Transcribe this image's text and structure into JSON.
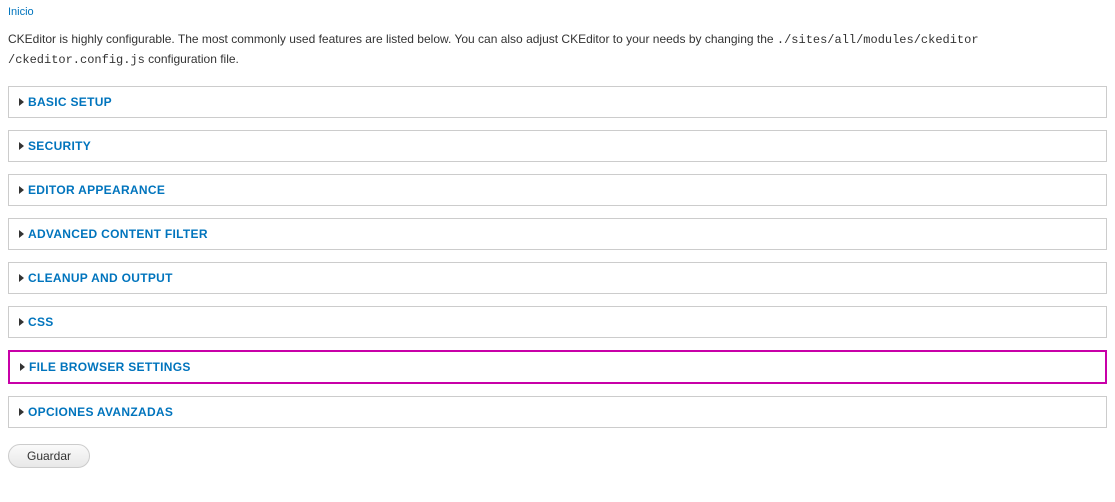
{
  "breadcrumb": {
    "home": "Inicio"
  },
  "description": {
    "text_before": "CKEditor is highly configurable. The most commonly used features are listed below. You can also adjust CKEditor to your needs by changing the ",
    "code1": "./sites/all/modules/ckeditor",
    "code2": "/ckeditor.config.js",
    "text_after": " configuration file."
  },
  "fieldsets": [
    {
      "label": "BASIC SETUP"
    },
    {
      "label": "SECURITY"
    },
    {
      "label": "EDITOR APPEARANCE"
    },
    {
      "label": "ADVANCED CONTENT FILTER"
    },
    {
      "label": "CLEANUP AND OUTPUT"
    },
    {
      "label": "CSS"
    },
    {
      "label": "FILE BROWSER SETTINGS"
    },
    {
      "label": "OPCIONES AVANZADAS"
    }
  ],
  "highlighted_index": 6,
  "actions": {
    "save_label": "Guardar"
  }
}
